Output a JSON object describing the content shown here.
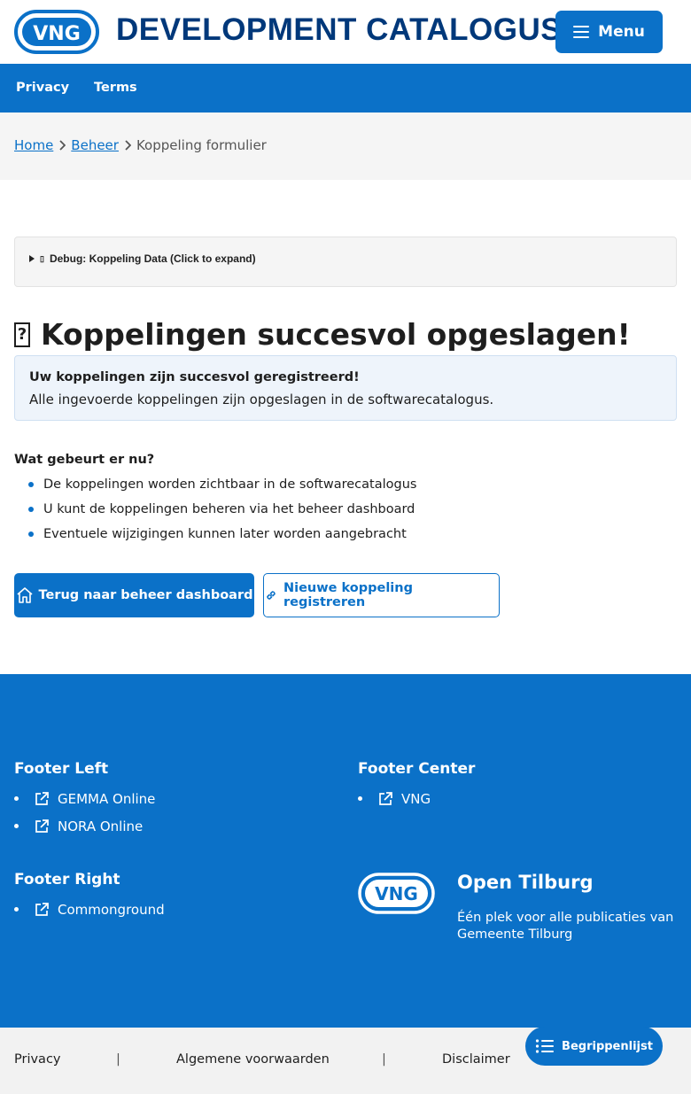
{
  "header": {
    "logo_text": "VNG",
    "site_title": "DEVELOPMENT CATALOGUS",
    "menu_label": "Menu"
  },
  "topnav": {
    "items": [
      {
        "label": "Privacy"
      },
      {
        "label": "Terms"
      }
    ]
  },
  "breadcrumb": {
    "items": [
      {
        "label": "Home",
        "link": true
      },
      {
        "label": "Beheer",
        "link": true
      },
      {
        "label": "Koppeling formulier",
        "link": false
      }
    ]
  },
  "debug": {
    "summary": "Debug: Koppeling Data (Click to expand)",
    "icon_glyph": "▯"
  },
  "main": {
    "heading": "Koppelingen succesvol opgeslagen!",
    "heading_icon": "?",
    "alert_title": "Uw koppelingen zijn succesvol geregistreerd!",
    "alert_text": "Alle ingevoerde koppelingen zijn opgeslagen in de softwarecatalogus.",
    "next_title": "Wat gebeurt er nu?",
    "steps": [
      "De koppelingen worden zichtbaar in de softwarecatalogus",
      "U kunt de koppelingen beheren via het beheer dashboard",
      "Eventuele wijzigingen kunnen later worden aangebracht"
    ],
    "primary_button": "Terug naar beheer dashboard",
    "secondary_button": "Nieuwe koppeling registreren"
  },
  "footer": {
    "left_title": "Footer Left",
    "left_links": [
      "GEMMA Online",
      "NORA Online"
    ],
    "center_title": "Footer Center",
    "center_links": [
      "VNG"
    ],
    "right_title": "Footer Right",
    "right_links": [
      "Commonground"
    ],
    "org_name": "Open Tilburg",
    "org_desc": "Één plek voor alle publicaties van Gemeente Tilburg",
    "logo_text": "VNG"
  },
  "bottombar": {
    "links": [
      "Privacy",
      "Algemene voorwaarden",
      "Disclaimer"
    ],
    "separator": "|"
  },
  "floating": {
    "label": "Begrippenlijst"
  },
  "colors": {
    "primary": "#0b71c8",
    "title_navy": "#00387a"
  }
}
